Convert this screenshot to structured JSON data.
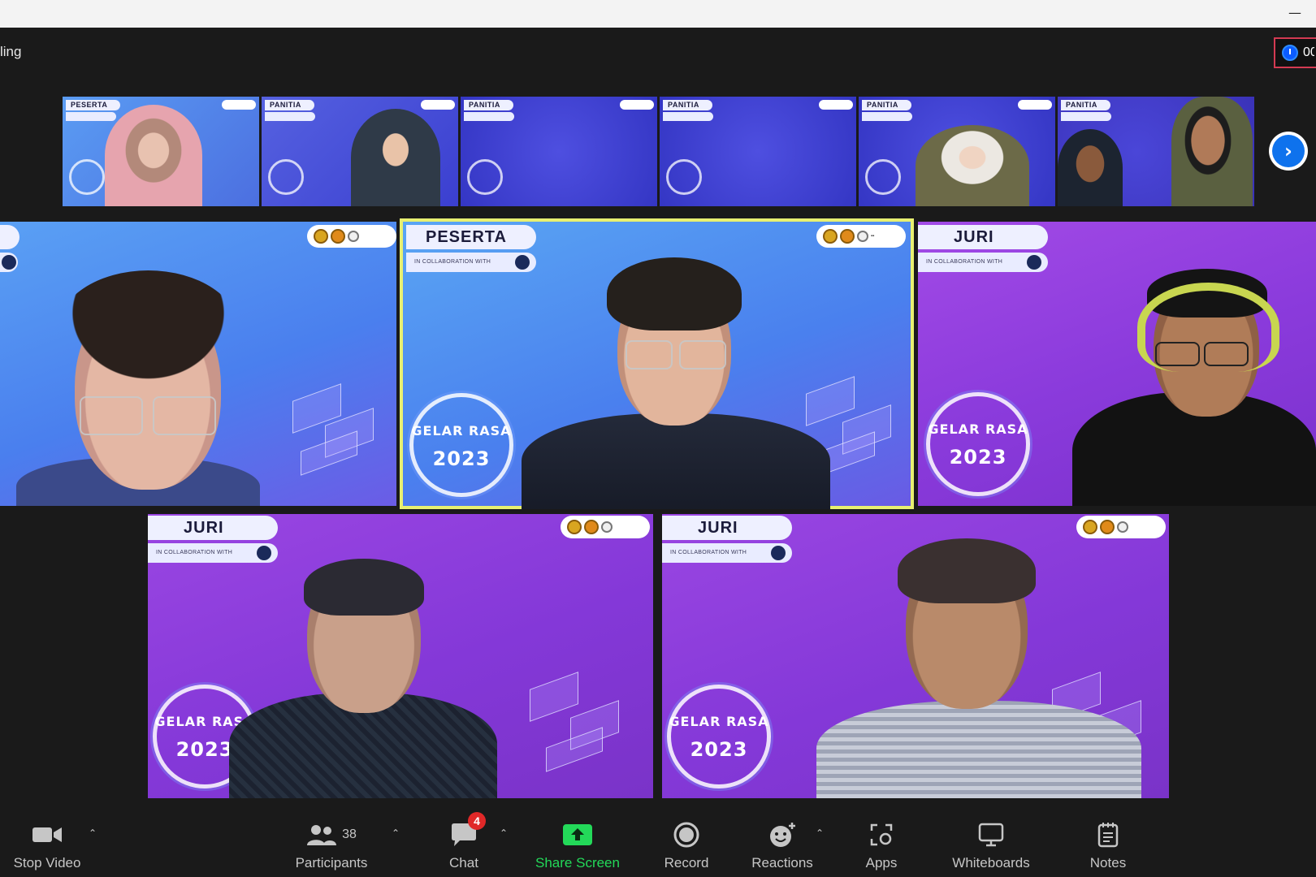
{
  "meeting": {
    "recording_label": "ling",
    "timer_text": "00",
    "thumbnails": [
      {
        "tag": "PESERTA",
        "bg": "#4f7fe8"
      },
      {
        "tag": "PANITIA",
        "bg": "#4b52d8"
      },
      {
        "tag": "PANITIA",
        "bg": "#4648d6"
      },
      {
        "tag": "PANITIA",
        "bg": "#4648d6"
      },
      {
        "tag": "PANITIA",
        "bg": "#4648d6"
      },
      {
        "tag": "PANITIA",
        "bg": "#4a44d0"
      }
    ],
    "tiles": [
      {
        "tag": "",
        "collab": "",
        "badge_line1": "",
        "badge_line2": "",
        "bg": "#4a86ef"
      },
      {
        "tag": "PESERTA",
        "collab": "IN COLLABORATION WITH",
        "badge_line1": "GELAR RASA",
        "badge_line2": "2023",
        "bg": "#4b86f0"
      },
      {
        "tag": "JURI",
        "collab": "IN COLLABORATION WITH",
        "badge_line1": "GELAR RASA",
        "badge_line2": "2023",
        "bg": "#9a3ee0"
      },
      {
        "tag": "JURI",
        "collab": "IN COLLABORATION WITH",
        "badge_line1": "GELAR RASA",
        "badge_line2": "2023",
        "bg": "#8e3be0"
      },
      {
        "tag": "JURI",
        "collab": "IN COLLABORATION WITH",
        "badge_line1": "GELAR RASA",
        "badge_line2": "2023",
        "bg": "#8e3be0"
      }
    ]
  },
  "toolbar": {
    "stop_video": "Stop Video",
    "participants": "Participants",
    "participants_count": "38",
    "chat": "Chat",
    "chat_badge": "4",
    "share_screen": "Share Screen",
    "record": "Record",
    "reactions": "Reactions",
    "apps": "Apps",
    "whiteboards": "Whiteboards",
    "notes": "Notes"
  },
  "colors": {
    "accent_blue": "#0e72ed",
    "share_green": "#23d959",
    "active_speaker_border": "#e8f071",
    "chat_badge_red": "#e02828",
    "timer_border": "#d33a52"
  },
  "icons": {
    "video": "video-camera-icon",
    "participants": "people-icon",
    "chat": "chat-bubble-icon",
    "share": "share-arrow-icon",
    "record": "record-circle-icon",
    "reactions": "smiley-plus-icon",
    "apps": "apps-grid-icon",
    "whiteboards": "whiteboard-icon",
    "notes": "notepad-icon",
    "next": "chevron-right-icon",
    "timer": "stopwatch-icon"
  }
}
